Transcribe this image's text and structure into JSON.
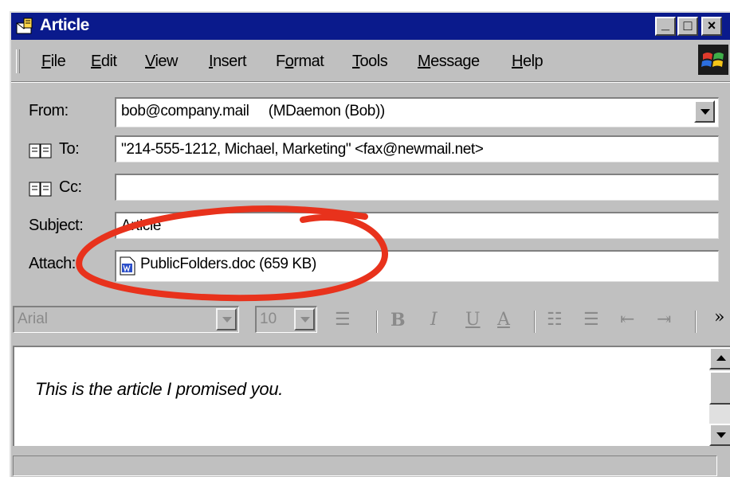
{
  "window": {
    "title": "Article"
  },
  "titlebar_buttons": {
    "minimize": "_",
    "maximize": "□",
    "close": "×"
  },
  "menu": [
    "File",
    "Edit",
    "View",
    "Insert",
    "Format",
    "Tools",
    "Message",
    "Help"
  ],
  "menu_underlines": [
    "F",
    "E",
    "V",
    "I",
    "o",
    "T",
    "M",
    "H"
  ],
  "fields": {
    "from": {
      "label": "From:",
      "value": "bob@company.mail     (MDaemon (Bob))"
    },
    "to": {
      "label": "To:",
      "value": "\"214-555-1212, Michael, Marketing\" <fax@newmail.net>"
    },
    "cc": {
      "label": "Cc:",
      "value": ""
    },
    "subject": {
      "label": "Subject:",
      "value": "Article"
    },
    "attach": {
      "label": "Attach:",
      "file": "PublicFolders.doc (659 KB)"
    }
  },
  "format_toolbar": {
    "font": "Arial",
    "size": "10",
    "glyphs": {
      "para": "☰",
      "bold": "B",
      "italic": "I",
      "underline": "U",
      "color": "A",
      "numbered": "☷",
      "bulleted": "☰",
      "outdent": "⇤",
      "indent": "⇥",
      "more": "»"
    }
  },
  "message_body": "This is the article I promised you.",
  "colors": {
    "titlebar": "#0a1a8c",
    "window": "#c0c0c0",
    "annotation": "#e8321c"
  },
  "icons": [
    "app-envelope-icon",
    "windows-logo-icon",
    "address-book-icon",
    "word-document-icon"
  ]
}
